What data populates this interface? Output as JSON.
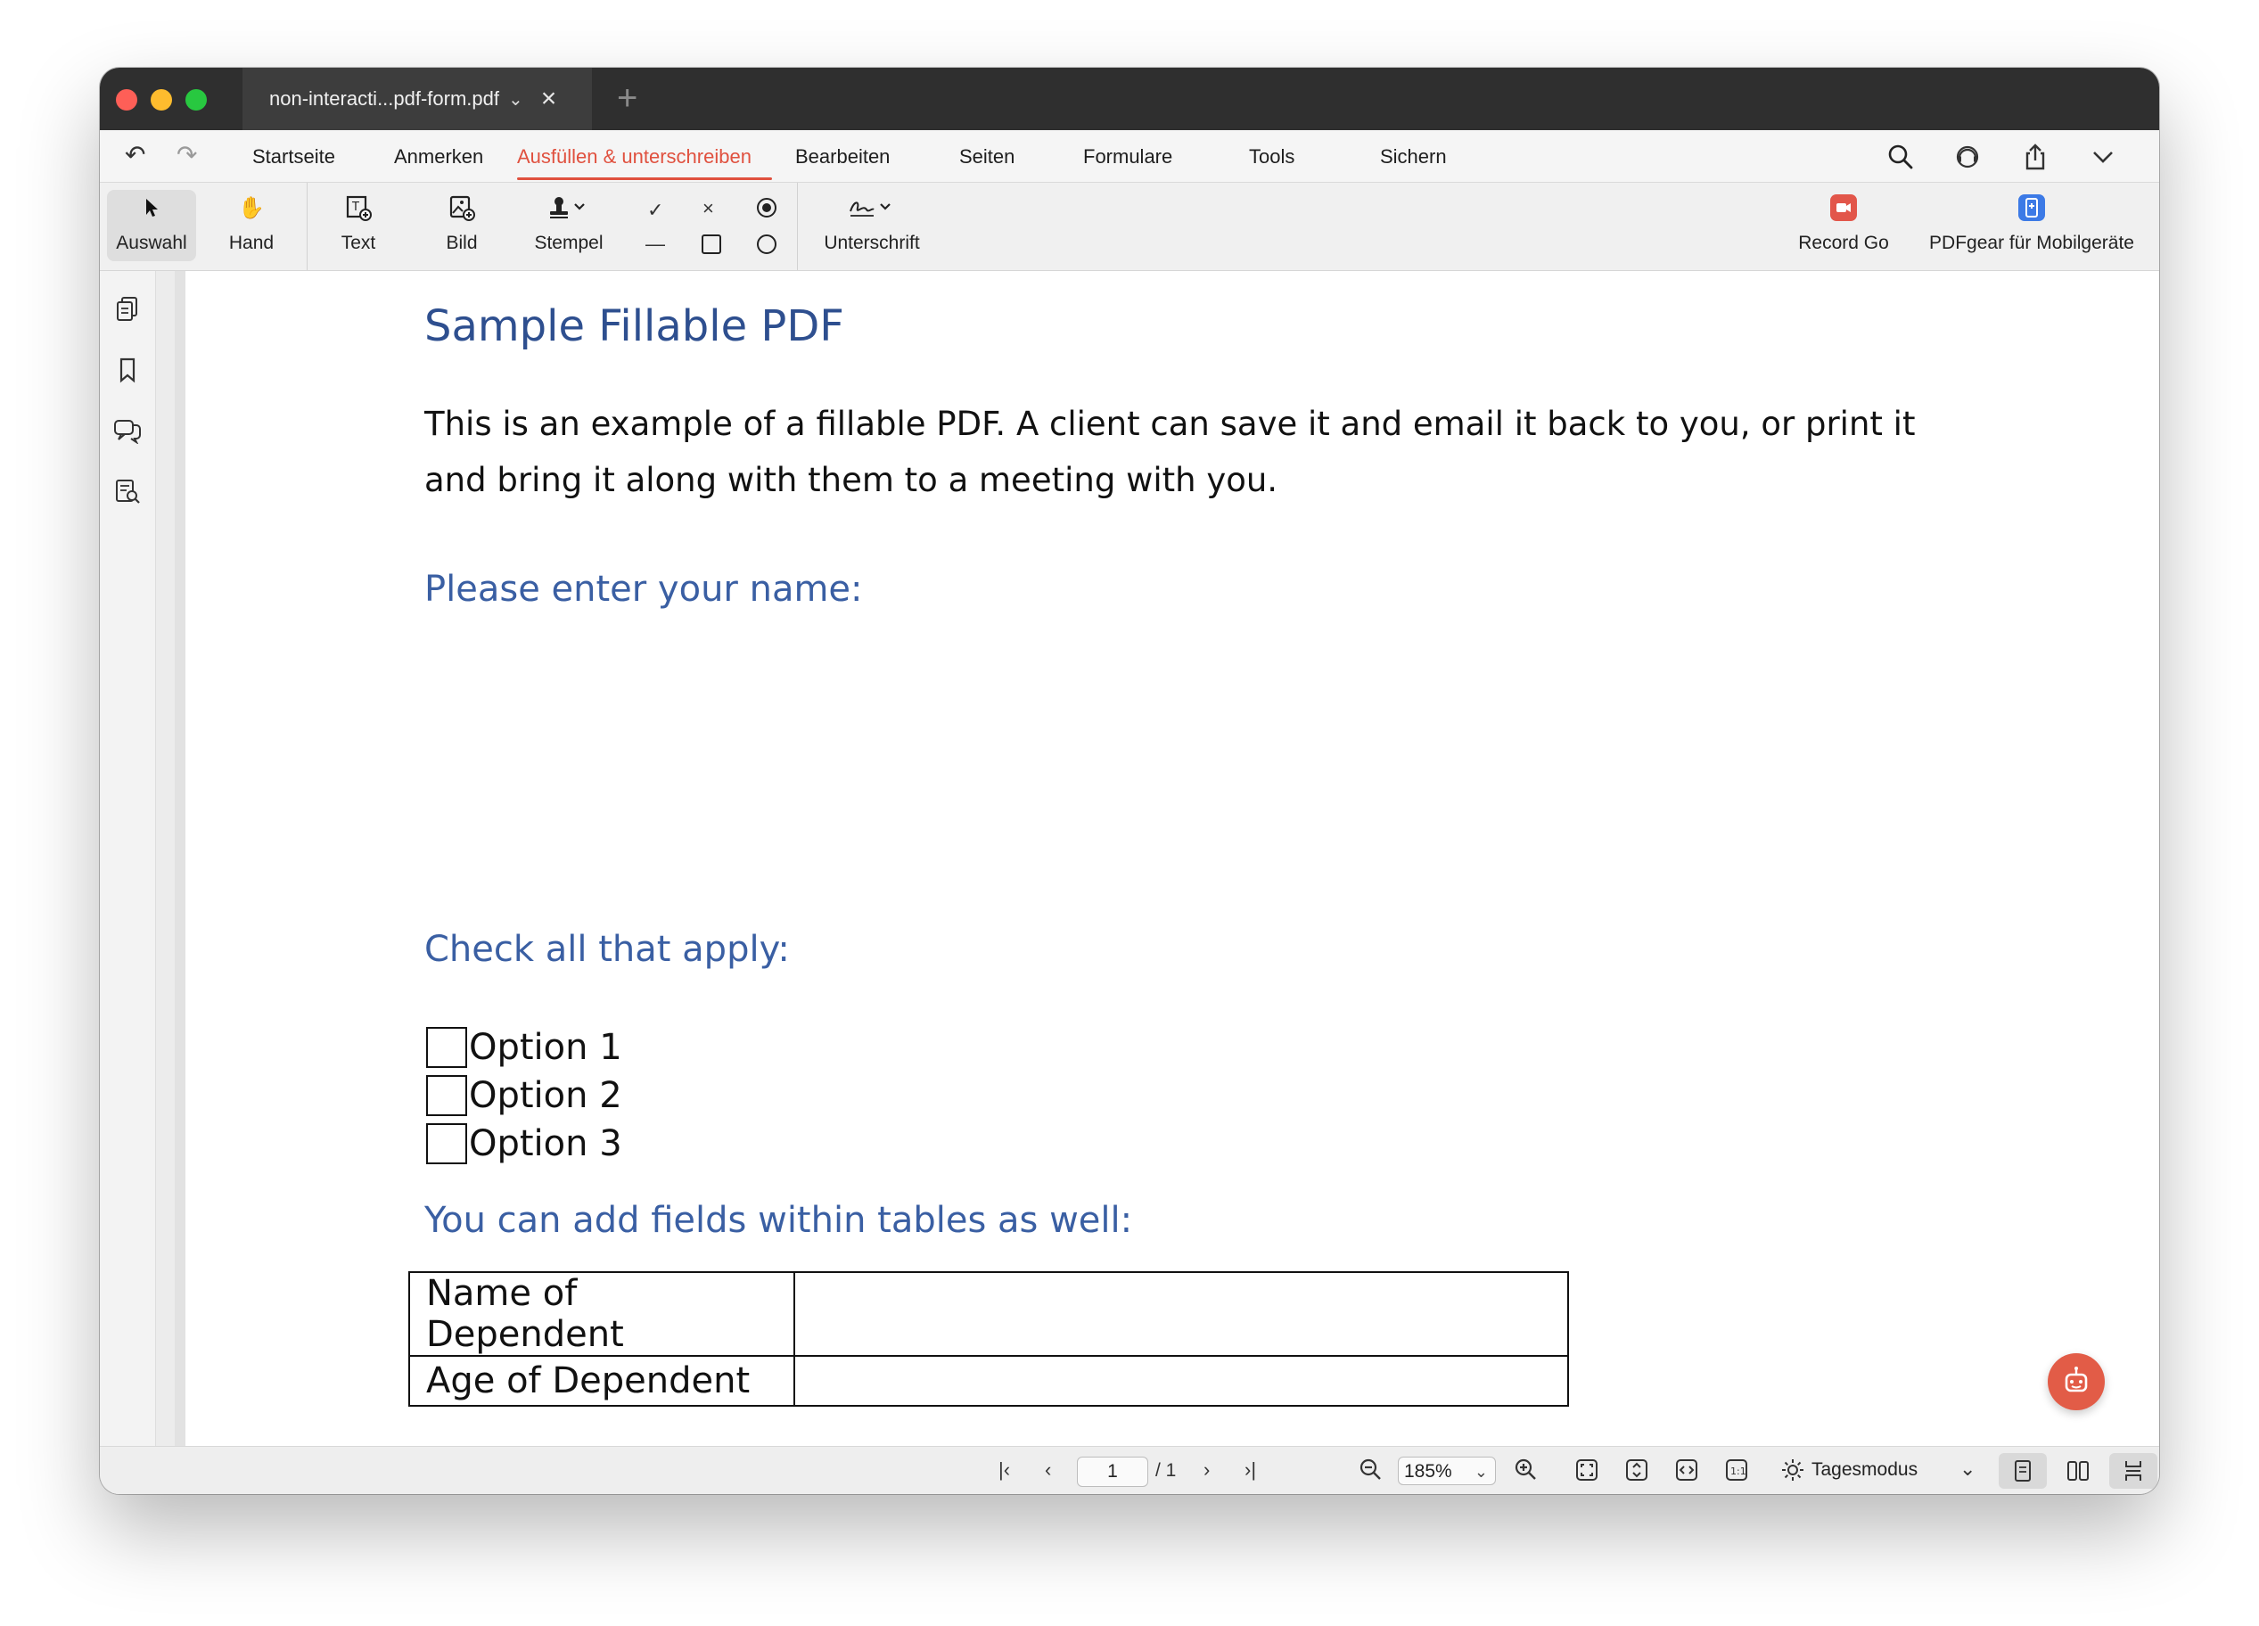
{
  "tab": {
    "title": "non-interacti...pdf-form.pdf"
  },
  "menu": {
    "items": [
      "Startseite",
      "Anmerken",
      "Ausfüllen & unterschreiben",
      "Bearbeiten",
      "Seiten",
      "Formulare",
      "Tools",
      "Sichern"
    ],
    "active": "Ausfüllen & unterschreiben",
    "accent": "#e0513f"
  },
  "toolbar": {
    "select": "Auswahl",
    "hand": "Hand",
    "text": "Text",
    "image": "Bild",
    "stamp": "Stempel",
    "signature": "Unterschrift",
    "record": "Record Go",
    "mobile": "PDFgear für Mobilgeräte"
  },
  "document": {
    "title": "Sample Fillable PDF",
    "intro": "This is an example of a fillable PDF. A client can save it and email it back to you, or print it and bring it along with them to a meeting with you.",
    "name_heading": "Please enter your name:",
    "check_heading": "Check all that apply:",
    "options": [
      "Option 1",
      "Option 2",
      "Option 3"
    ],
    "table_heading": "You can add  fields within tables as well:",
    "table_rows": [
      "Name of Dependent",
      "Age of Dependent"
    ],
    "title_color": "#2e4f8f"
  },
  "statusbar": {
    "current_page": "1",
    "total_pages": "/ 1",
    "zoom": "185%",
    "mode": "Tagesmodus"
  }
}
